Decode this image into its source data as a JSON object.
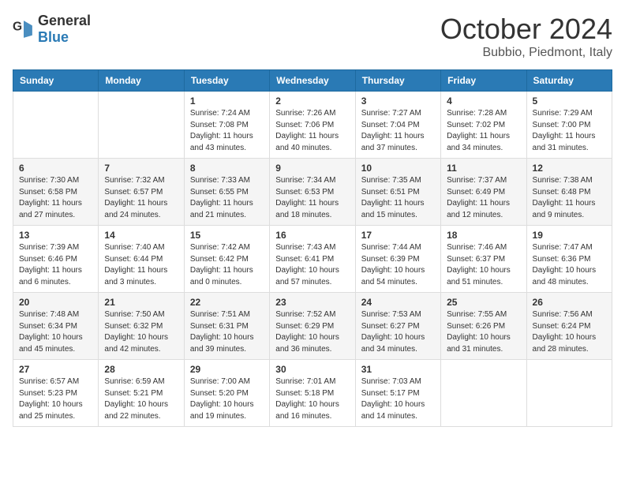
{
  "logo": {
    "general": "General",
    "blue": "Blue"
  },
  "title": "October 2024",
  "location": "Bubbio, Piedmont, Italy",
  "days_of_week": [
    "Sunday",
    "Monday",
    "Tuesday",
    "Wednesday",
    "Thursday",
    "Friday",
    "Saturday"
  ],
  "weeks": [
    [
      null,
      null,
      {
        "day": "1",
        "sunrise": "Sunrise: 7:24 AM",
        "sunset": "Sunset: 7:08 PM",
        "daylight": "Daylight: 11 hours and 43 minutes."
      },
      {
        "day": "2",
        "sunrise": "Sunrise: 7:26 AM",
        "sunset": "Sunset: 7:06 PM",
        "daylight": "Daylight: 11 hours and 40 minutes."
      },
      {
        "day": "3",
        "sunrise": "Sunrise: 7:27 AM",
        "sunset": "Sunset: 7:04 PM",
        "daylight": "Daylight: 11 hours and 37 minutes."
      },
      {
        "day": "4",
        "sunrise": "Sunrise: 7:28 AM",
        "sunset": "Sunset: 7:02 PM",
        "daylight": "Daylight: 11 hours and 34 minutes."
      },
      {
        "day": "5",
        "sunrise": "Sunrise: 7:29 AM",
        "sunset": "Sunset: 7:00 PM",
        "daylight": "Daylight: 11 hours and 31 minutes."
      }
    ],
    [
      {
        "day": "6",
        "sunrise": "Sunrise: 7:30 AM",
        "sunset": "Sunset: 6:58 PM",
        "daylight": "Daylight: 11 hours and 27 minutes."
      },
      {
        "day": "7",
        "sunrise": "Sunrise: 7:32 AM",
        "sunset": "Sunset: 6:57 PM",
        "daylight": "Daylight: 11 hours and 24 minutes."
      },
      {
        "day": "8",
        "sunrise": "Sunrise: 7:33 AM",
        "sunset": "Sunset: 6:55 PM",
        "daylight": "Daylight: 11 hours and 21 minutes."
      },
      {
        "day": "9",
        "sunrise": "Sunrise: 7:34 AM",
        "sunset": "Sunset: 6:53 PM",
        "daylight": "Daylight: 11 hours and 18 minutes."
      },
      {
        "day": "10",
        "sunrise": "Sunrise: 7:35 AM",
        "sunset": "Sunset: 6:51 PM",
        "daylight": "Daylight: 11 hours and 15 minutes."
      },
      {
        "day": "11",
        "sunrise": "Sunrise: 7:37 AM",
        "sunset": "Sunset: 6:49 PM",
        "daylight": "Daylight: 11 hours and 12 minutes."
      },
      {
        "day": "12",
        "sunrise": "Sunrise: 7:38 AM",
        "sunset": "Sunset: 6:48 PM",
        "daylight": "Daylight: 11 hours and 9 minutes."
      }
    ],
    [
      {
        "day": "13",
        "sunrise": "Sunrise: 7:39 AM",
        "sunset": "Sunset: 6:46 PM",
        "daylight": "Daylight: 11 hours and 6 minutes."
      },
      {
        "day": "14",
        "sunrise": "Sunrise: 7:40 AM",
        "sunset": "Sunset: 6:44 PM",
        "daylight": "Daylight: 11 hours and 3 minutes."
      },
      {
        "day": "15",
        "sunrise": "Sunrise: 7:42 AM",
        "sunset": "Sunset: 6:42 PM",
        "daylight": "Daylight: 11 hours and 0 minutes."
      },
      {
        "day": "16",
        "sunrise": "Sunrise: 7:43 AM",
        "sunset": "Sunset: 6:41 PM",
        "daylight": "Daylight: 10 hours and 57 minutes."
      },
      {
        "day": "17",
        "sunrise": "Sunrise: 7:44 AM",
        "sunset": "Sunset: 6:39 PM",
        "daylight": "Daylight: 10 hours and 54 minutes."
      },
      {
        "day": "18",
        "sunrise": "Sunrise: 7:46 AM",
        "sunset": "Sunset: 6:37 PM",
        "daylight": "Daylight: 10 hours and 51 minutes."
      },
      {
        "day": "19",
        "sunrise": "Sunrise: 7:47 AM",
        "sunset": "Sunset: 6:36 PM",
        "daylight": "Daylight: 10 hours and 48 minutes."
      }
    ],
    [
      {
        "day": "20",
        "sunrise": "Sunrise: 7:48 AM",
        "sunset": "Sunset: 6:34 PM",
        "daylight": "Daylight: 10 hours and 45 minutes."
      },
      {
        "day": "21",
        "sunrise": "Sunrise: 7:50 AM",
        "sunset": "Sunset: 6:32 PM",
        "daylight": "Daylight: 10 hours and 42 minutes."
      },
      {
        "day": "22",
        "sunrise": "Sunrise: 7:51 AM",
        "sunset": "Sunset: 6:31 PM",
        "daylight": "Daylight: 10 hours and 39 minutes."
      },
      {
        "day": "23",
        "sunrise": "Sunrise: 7:52 AM",
        "sunset": "Sunset: 6:29 PM",
        "daylight": "Daylight: 10 hours and 36 minutes."
      },
      {
        "day": "24",
        "sunrise": "Sunrise: 7:53 AM",
        "sunset": "Sunset: 6:27 PM",
        "daylight": "Daylight: 10 hours and 34 minutes."
      },
      {
        "day": "25",
        "sunrise": "Sunrise: 7:55 AM",
        "sunset": "Sunset: 6:26 PM",
        "daylight": "Daylight: 10 hours and 31 minutes."
      },
      {
        "day": "26",
        "sunrise": "Sunrise: 7:56 AM",
        "sunset": "Sunset: 6:24 PM",
        "daylight": "Daylight: 10 hours and 28 minutes."
      }
    ],
    [
      {
        "day": "27",
        "sunrise": "Sunrise: 6:57 AM",
        "sunset": "Sunset: 5:23 PM",
        "daylight": "Daylight: 10 hours and 25 minutes."
      },
      {
        "day": "28",
        "sunrise": "Sunrise: 6:59 AM",
        "sunset": "Sunset: 5:21 PM",
        "daylight": "Daylight: 10 hours and 22 minutes."
      },
      {
        "day": "29",
        "sunrise": "Sunrise: 7:00 AM",
        "sunset": "Sunset: 5:20 PM",
        "daylight": "Daylight: 10 hours and 19 minutes."
      },
      {
        "day": "30",
        "sunrise": "Sunrise: 7:01 AM",
        "sunset": "Sunset: 5:18 PM",
        "daylight": "Daylight: 10 hours and 16 minutes."
      },
      {
        "day": "31",
        "sunrise": "Sunrise: 7:03 AM",
        "sunset": "Sunset: 5:17 PM",
        "daylight": "Daylight: 10 hours and 14 minutes."
      },
      null,
      null
    ]
  ]
}
